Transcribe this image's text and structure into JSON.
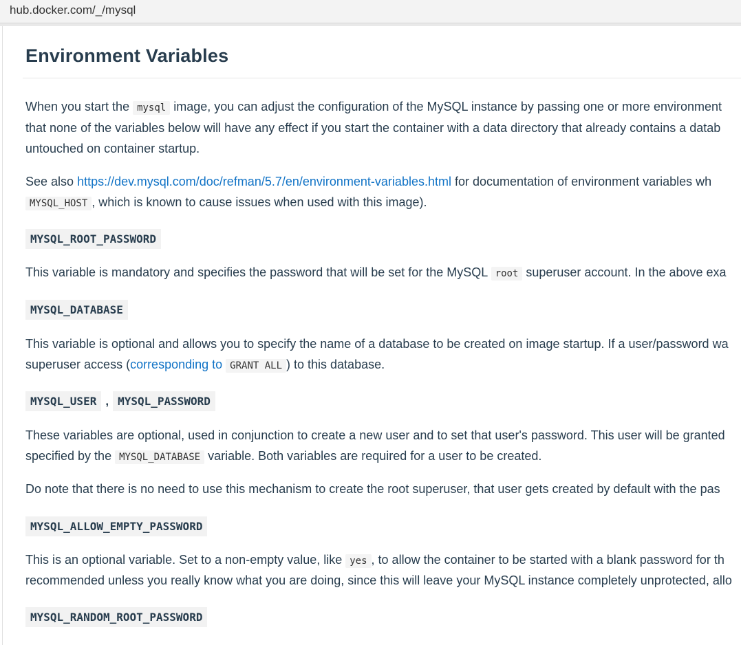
{
  "browser": {
    "url": "hub.docker.com/_/mysql"
  },
  "section": {
    "title": "Environment Variables"
  },
  "intro": {
    "l1_pre": "When you start the ",
    "l1_code": "mysql",
    "l1_post": " image, you can adjust the configuration of the MySQL instance by passing one or more environment",
    "l2": "that none of the variables below will have any effect if you start the container with a data directory that already contains a datab",
    "l3": "untouched on container startup."
  },
  "see_also": {
    "l1_pre": "See also ",
    "link": "https://dev.mysql.com/doc/refman/5.7/en/environment-variables.html",
    "l1_post": " for documentation of environment variables wh",
    "l2_code": "MYSQL_HOST",
    "l2_post": ", which is known to cause issues when used with this image)."
  },
  "vars": {
    "root_password": {
      "name": "MYSQL_ROOT_PASSWORD",
      "d_pre": "This variable is mandatory and specifies the password that will be set for the MySQL ",
      "d_code": "root",
      "d_post": " superuser account. In the above exa"
    },
    "database": {
      "name": "MYSQL_DATABASE",
      "l1": "This variable is optional and allows you to specify the name of a database to be created on image startup. If a user/password wa",
      "l2_pre": "superuser access (",
      "l2_link": "corresponding to ",
      "l2_code": "GRANT ALL",
      "l2_post": ") to this database."
    },
    "user_password": {
      "name1": "MYSQL_USER",
      "sep": ",",
      "name2": "MYSQL_PASSWORD",
      "l1": "These variables are optional, used in conjunction to create a new user and to set that user's password. This user will be granted",
      "l2_pre": "specified by the ",
      "l2_code": "MYSQL_DATABASE",
      "l2_post": " variable. Both variables are required for a user to be created.",
      "note": "Do note that there is no need to use this mechanism to create the root superuser, that user gets created by default with the pas"
    },
    "allow_empty": {
      "name": "MYSQL_ALLOW_EMPTY_PASSWORD",
      "l1_pre": "This is an optional variable. Set to a non-empty value, like ",
      "l1_code": "yes",
      "l1_post": ", to allow the container to be started with a blank password for th",
      "l2": "recommended unless you really know what you are doing, since this will leave your MySQL instance completely unprotected, allo"
    },
    "random_root": {
      "name": "MYSQL_RANDOM_ROOT_PASSWORD"
    }
  }
}
